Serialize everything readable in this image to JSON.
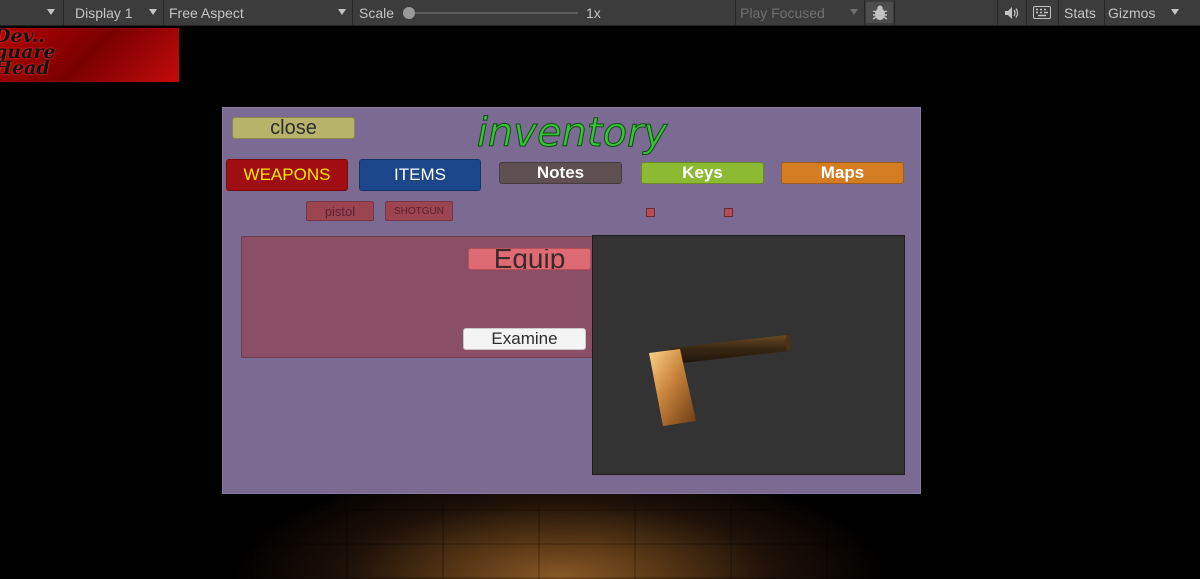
{
  "toolbar": {
    "display": "Display 1",
    "aspect": "Free Aspect",
    "scale_label": "Scale",
    "scale_value": "1x",
    "scale_fraction": 0.0,
    "play_mode": "Play Focused",
    "stats": "Stats",
    "gizmos": "Gizmos"
  },
  "logo": {
    "lines": [
      "Dev..",
      "quare",
      "Head"
    ]
  },
  "inventory": {
    "title": "inventory",
    "close": "close",
    "categories": [
      {
        "label": "WEAPONS",
        "bg": "#a00e12",
        "fg": "#ffe600"
      },
      {
        "label": "ITEMS",
        "bg": "#1b478a",
        "fg": "#ffffff"
      },
      {
        "label": "Notes",
        "bg": "#5e5050",
        "fg": "#ffffff"
      },
      {
        "label": "Keys",
        "bg": "#8cba32",
        "fg": "#ffffff"
      },
      {
        "label": "Maps",
        "bg": "#d37c21",
        "fg": "#ffffff"
      }
    ],
    "weapons": [
      "pistol",
      "SHOTGUN"
    ],
    "equip": "Equip",
    "examine": "Examine"
  },
  "colors": {
    "panel": "#7b6a91",
    "title_green": "#37c23a",
    "detail_panel": "#8a4f64",
    "preview_bg": "#333333"
  },
  "icons": {
    "audio": "speaker-icon",
    "stats_keyboard": "keyboard-icon",
    "bug": "bug-icon"
  }
}
